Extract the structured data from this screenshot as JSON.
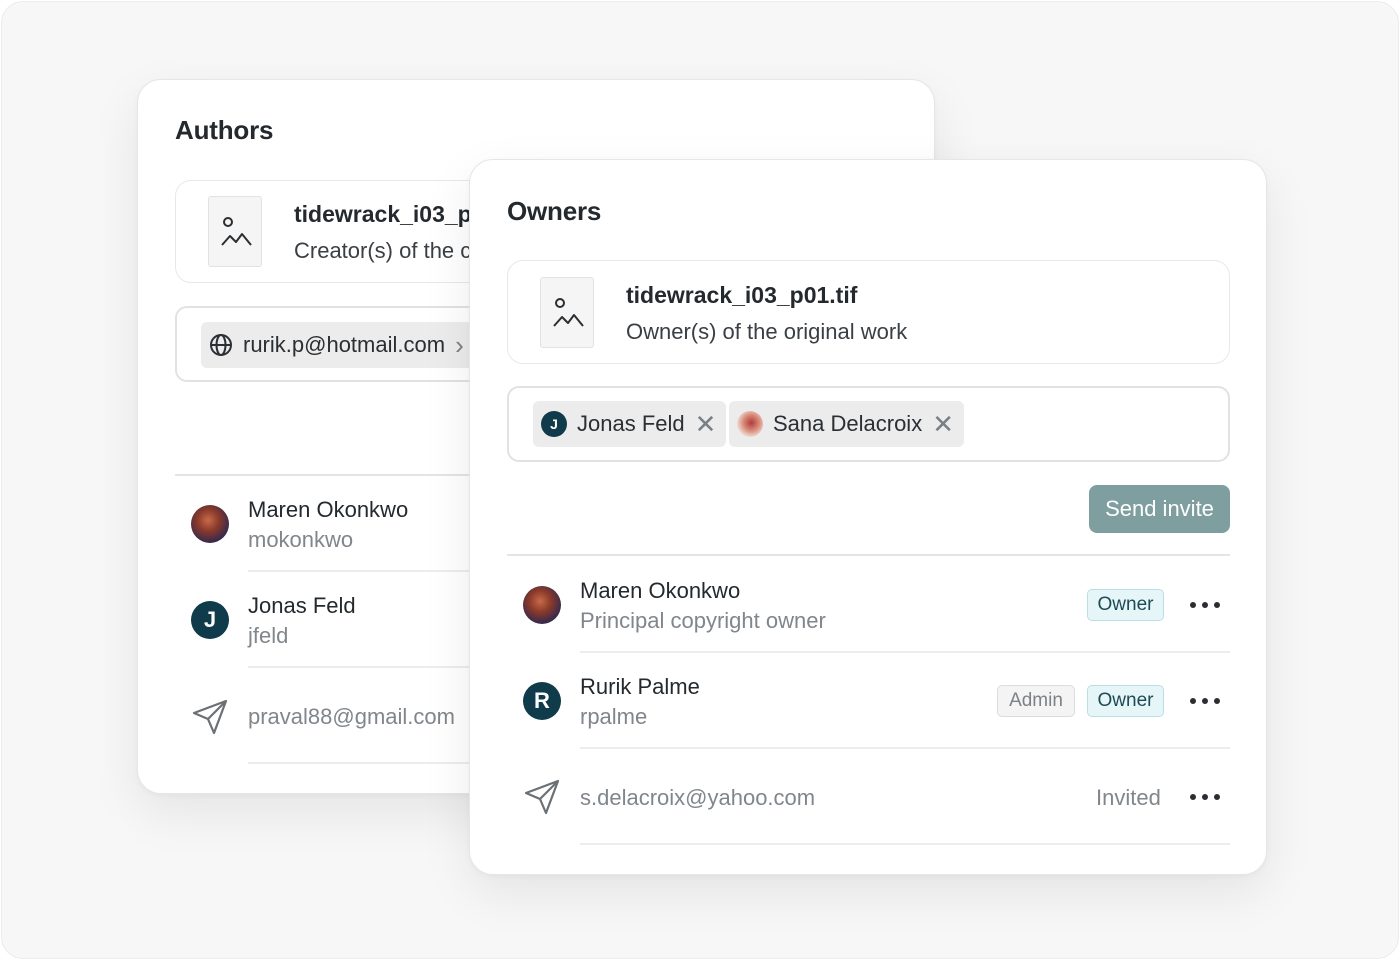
{
  "authors": {
    "title": "Authors",
    "file": {
      "name": "tidewrack_i03_p",
      "description": "Creator(s) of the c"
    },
    "chip": {
      "label": "rurik.p@hotmail.com",
      "close": "›"
    },
    "members": [
      {
        "name": "Maren Okonkwo",
        "sub": "mokonkwo",
        "avatar": "photo"
      },
      {
        "name": "Jonas Feld",
        "sub": "jfeld",
        "avatar_letter": "J"
      }
    ],
    "invite": {
      "email": "praval88@gmail.com"
    }
  },
  "owners": {
    "title": "Owners",
    "file": {
      "name": "tidewrack_i03_p01.tif",
      "description": "Owner(s) of the original work"
    },
    "chips": [
      {
        "label": "Jonas Feld",
        "letter": "J",
        "close": "✕"
      },
      {
        "label": "Sana Delacroix",
        "close": "✕"
      }
    ],
    "send_label": "Send invite",
    "members": [
      {
        "name": "Maren Okonkwo",
        "sub": "Principal copyright owner",
        "badges": [
          "Owner"
        ]
      },
      {
        "name": "Rurik Palme",
        "sub": "rpalme",
        "avatar_letter": "R",
        "badges": [
          "Admin",
          "Owner"
        ]
      }
    ],
    "invite": {
      "email": "s.delacroix@yahoo.com",
      "status": "Invited"
    }
  },
  "colors": {
    "accent_button": "#7f9ea0",
    "avatar_teal": "#0f3b4a",
    "owner_badge_bg": "#e6f6f8"
  },
  "icons": [
    "image-placeholder-icon",
    "globe-icon",
    "send-icon",
    "more-icon",
    "close-icon"
  ]
}
